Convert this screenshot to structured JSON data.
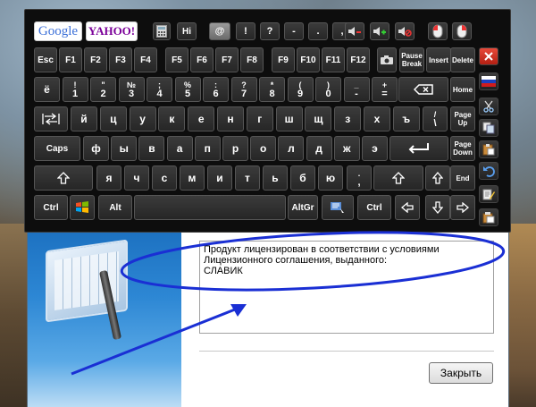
{
  "search_buttons": {
    "google": "Google",
    "yahoo": "YAHOO!"
  },
  "toolbar": {
    "hi": "Hi",
    "at": "@",
    "exclaim": "!",
    "question": "?",
    "dash": "-",
    "dot": ".",
    "comma": ","
  },
  "keys": {
    "row1": [
      "Esc",
      "F1",
      "F2",
      "F3",
      "F4",
      "F5",
      "F6",
      "F7",
      "F8",
      "F9",
      "F10",
      "F11",
      "F12"
    ],
    "pause_break": [
      "Pause",
      "Break"
    ],
    "insert": "Insert",
    "delete": "Delete",
    "row2": [
      {
        "top": "",
        "main": "ё"
      },
      {
        "top": "!",
        "main": "1"
      },
      {
        "top": "\"",
        "main": "2"
      },
      {
        "top": "№",
        "main": "3"
      },
      {
        "top": ";",
        "main": "4"
      },
      {
        "top": "%",
        "main": "5"
      },
      {
        "top": ":",
        "main": "6"
      },
      {
        "top": "?",
        "main": "7"
      },
      {
        "top": "*",
        "main": "8"
      },
      {
        "top": "(",
        "main": "9"
      },
      {
        "top": ")",
        "main": "0"
      },
      {
        "top": "_",
        "main": "-"
      },
      {
        "top": "+",
        "main": "="
      }
    ],
    "home": "Home",
    "row3": [
      "й",
      "ц",
      "у",
      "к",
      "е",
      "н",
      "г",
      "ш",
      "щ",
      "з",
      "х",
      "ъ"
    ],
    "backslash": [
      "/",
      "\\"
    ],
    "page_up": [
      "Page",
      "Up"
    ],
    "caps": "Caps",
    "row4": [
      "ф",
      "ы",
      "в",
      "а",
      "п",
      "р",
      "о",
      "л",
      "д",
      "ж",
      "э"
    ],
    "page_down": [
      "Page",
      "Down"
    ],
    "row5": [
      "я",
      "ч",
      "с",
      "м",
      "и",
      "т",
      "ь",
      "б",
      "ю"
    ],
    "period_comma": [
      ".",
      ","
    ],
    "end": "End",
    "ctrl": "Ctrl",
    "alt": "Alt",
    "altgr": "AltGr"
  },
  "dialog": {
    "license_lines": [
      "Продукт лицензирован в соответствии с условиями",
      "Лицензионного соглашения, выданного:",
      "СЛАВИК"
    ],
    "close_label": "Закрыть"
  },
  "colors": {
    "keyboard_bg": "#0d0d0d",
    "key_face": "#2e2e2e",
    "annotation_blue": "#1a2fd4"
  }
}
